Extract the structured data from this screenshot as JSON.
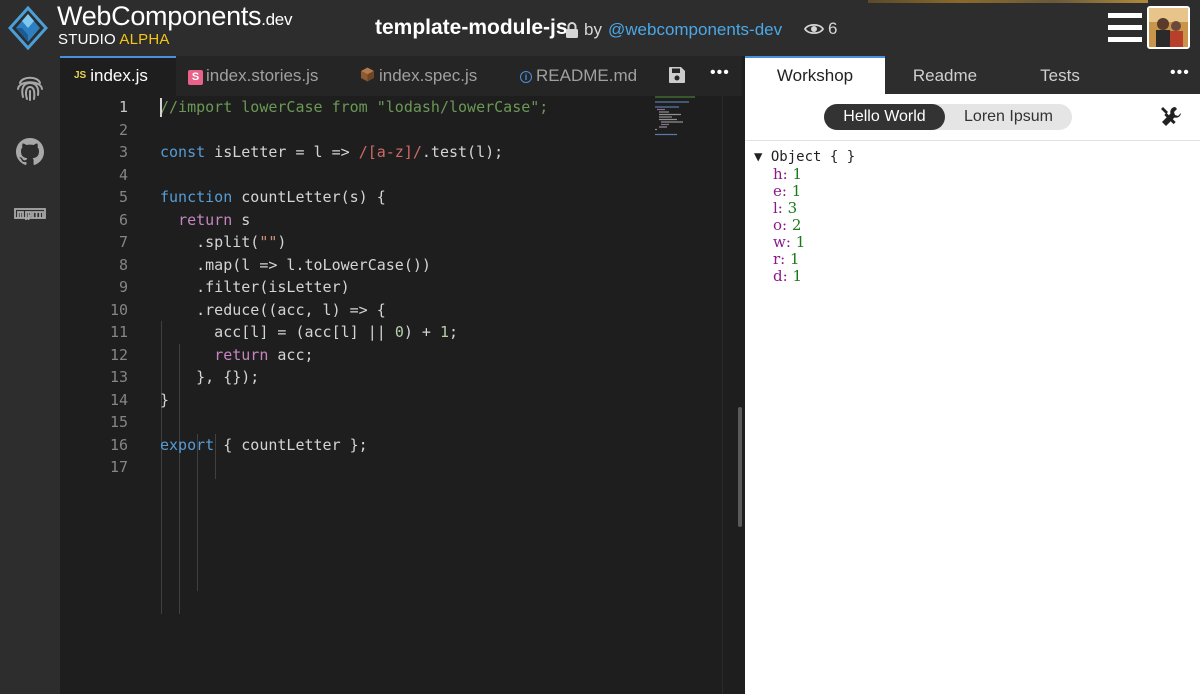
{
  "header": {
    "brand_name": "WebComponents",
    "brand_suffix": ".dev",
    "brand_sub": "STUDIO",
    "brand_alpha": "ALPHA",
    "project_title": "template-module-js",
    "by_label": "by",
    "author": "@webcomponents-dev",
    "views": "6"
  },
  "activity_bar": {
    "icons": [
      "fingerprint-icon",
      "github-icon",
      "npm-icon"
    ]
  },
  "editor_tabs": [
    {
      "label": "index.js",
      "badge": "JS",
      "active": true
    },
    {
      "label": "index.stories.js",
      "badge": "S",
      "active": false
    },
    {
      "label": "index.spec.js",
      "badge": "cube",
      "active": false
    },
    {
      "label": "README.md",
      "badge": "i",
      "active": false
    }
  ],
  "editor_more": "•••",
  "code_lines": [
    {
      "n": "1",
      "text": "//import lowerCase from \"lodash/lowerCase\";"
    },
    {
      "n": "2",
      "text": ""
    },
    {
      "n": "3",
      "text": "const isLetter = l => /[a-z]/.test(l);"
    },
    {
      "n": "4",
      "text": ""
    },
    {
      "n": "5",
      "text": "function countLetter(s) {"
    },
    {
      "n": "6",
      "text": "  return s"
    },
    {
      "n": "7",
      "text": "    .split(\"\")"
    },
    {
      "n": "8",
      "text": "    .map(l => l.toLowerCase())"
    },
    {
      "n": "9",
      "text": "    .filter(isLetter)"
    },
    {
      "n": "10",
      "text": "    .reduce((acc, l) => {"
    },
    {
      "n": "11",
      "text": "      acc[l] = (acc[l] || 0) + 1;"
    },
    {
      "n": "12",
      "text": "      return acc;"
    },
    {
      "n": "13",
      "text": "    }, {});"
    },
    {
      "n": "14",
      "text": "}"
    },
    {
      "n": "15",
      "text": ""
    },
    {
      "n": "16",
      "text": "export { countLetter };"
    },
    {
      "n": "17",
      "text": ""
    }
  ],
  "panel_tabs": [
    {
      "label": "Workshop",
      "active": true
    },
    {
      "label": "Readme",
      "active": false
    },
    {
      "label": "Tests",
      "active": false
    }
  ],
  "panel_more": "•••",
  "stories": [
    {
      "label": "Hello World",
      "selected": true
    },
    {
      "label": "Loren Ipsum",
      "selected": false
    }
  ],
  "output": {
    "object_label": "▼ Object { }",
    "props": [
      {
        "key": "h:",
        "value": "1"
      },
      {
        "key": "e:",
        "value": "1"
      },
      {
        "key": "l:",
        "value": "3"
      },
      {
        "key": "o:",
        "value": "2"
      },
      {
        "key": "w:",
        "value": "1"
      },
      {
        "key": "r:",
        "value": "1"
      },
      {
        "key": "d:",
        "value": "1"
      }
    ]
  },
  "colors": {
    "accent": "#4a90d9",
    "link": "#4aa8e8",
    "alpha": "#f5c518",
    "editor_bg": "#1e1e1e",
    "chrome_bg": "#2d2d2d"
  }
}
